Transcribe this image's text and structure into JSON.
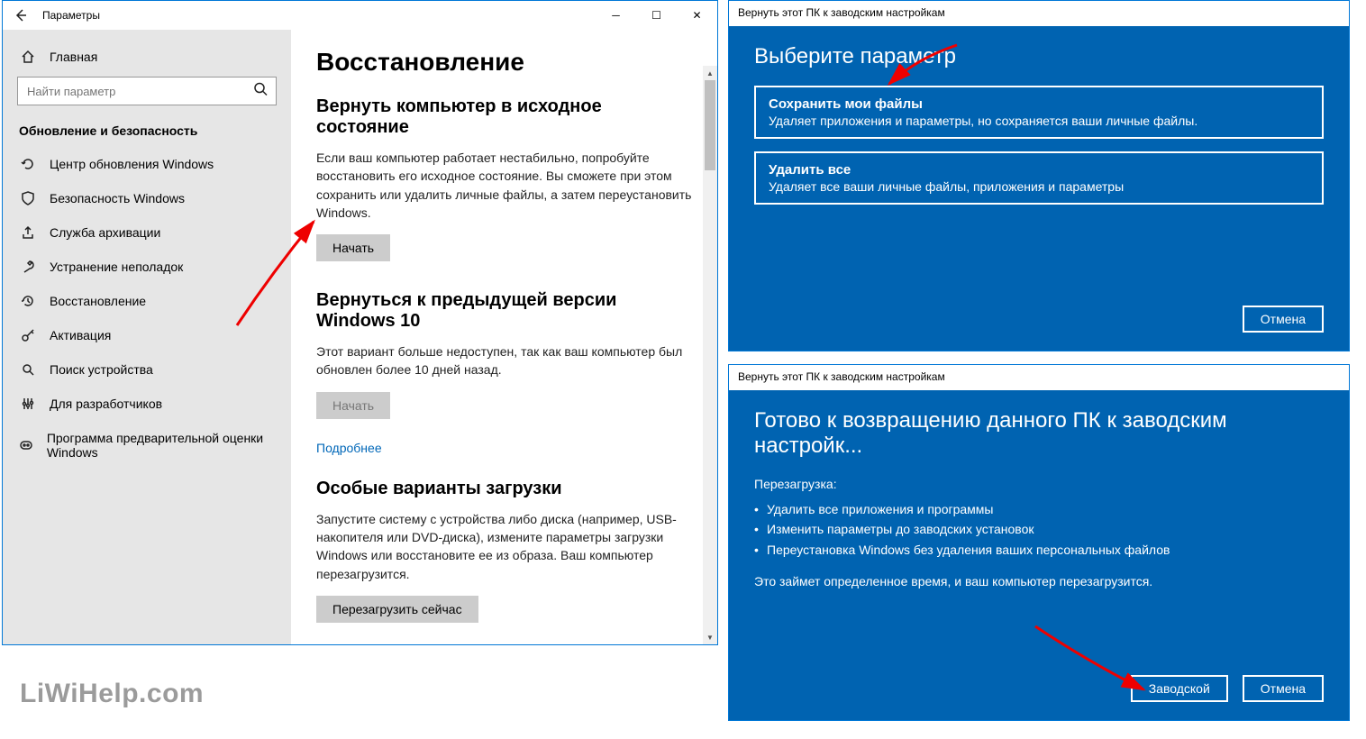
{
  "settings": {
    "title": "Параметры",
    "home": "Главная",
    "search_placeholder": "Найти параметр",
    "category": "Обновление и безопасность",
    "nav": [
      "Центр обновления Windows",
      "Безопасность Windows",
      "Служба архивации",
      "Устранение неполадок",
      "Восстановление",
      "Активация",
      "Поиск устройства",
      "Для разработчиков",
      "Программа предварительной оценки Windows"
    ],
    "main": {
      "heading": "Восстановление",
      "sec1_title": "Вернуть компьютер в исходное состояние",
      "sec1_text": "Если ваш компьютер работает нестабильно, попробуйте восстановить его исходное состояние. Вы сможете при этом сохранить или удалить личные файлы, а затем переустановить Windows.",
      "sec1_btn": "Начать",
      "sec2_title": "Вернуться к предыдущей версии Windows 10",
      "sec2_text": "Этот вариант больше недоступен, так как ваш компьютер был обновлен более 10 дней назад.",
      "sec2_btn": "Начать",
      "link": "Подробнее",
      "sec3_title": "Особые варианты загрузки",
      "sec3_text": "Запустите систему с устройства либо диска (например, USB-накопителя или DVD-диска), измените параметры загрузки Windows или восстановите ее из образа. Ваш компьютер перезагрузится.",
      "sec3_btn": "Перезагрузить сейчас"
    }
  },
  "dialog1": {
    "title": "Вернуть этот ПК к заводским настройкам",
    "heading": "Выберите параметр",
    "opt1_title": "Сохранить мои файлы",
    "opt1_desc": "Удаляет приложения и параметры, но сохраняется ваши личные файлы.",
    "opt2_title": "Удалить все",
    "opt2_desc": "Удаляет все ваши личные файлы, приложения и параметры",
    "cancel": "Отмена"
  },
  "dialog2": {
    "title": "Вернуть этот ПК к заводским настройкам",
    "heading": "Готово к возвращению данного ПК к заводским настройк...",
    "subtitle": "Перезагрузка:",
    "b1": "Удалить все приложения и программы",
    "b2": "Изменить параметры до заводских установок",
    "b3": "Переустановка Windows без удаления ваших персональных файлов",
    "note": "Это займет определенное время, и ваш компьютер перезагрузится.",
    "factory": "Заводской",
    "cancel": "Отмена"
  },
  "watermark": "LiWiHelp.com"
}
